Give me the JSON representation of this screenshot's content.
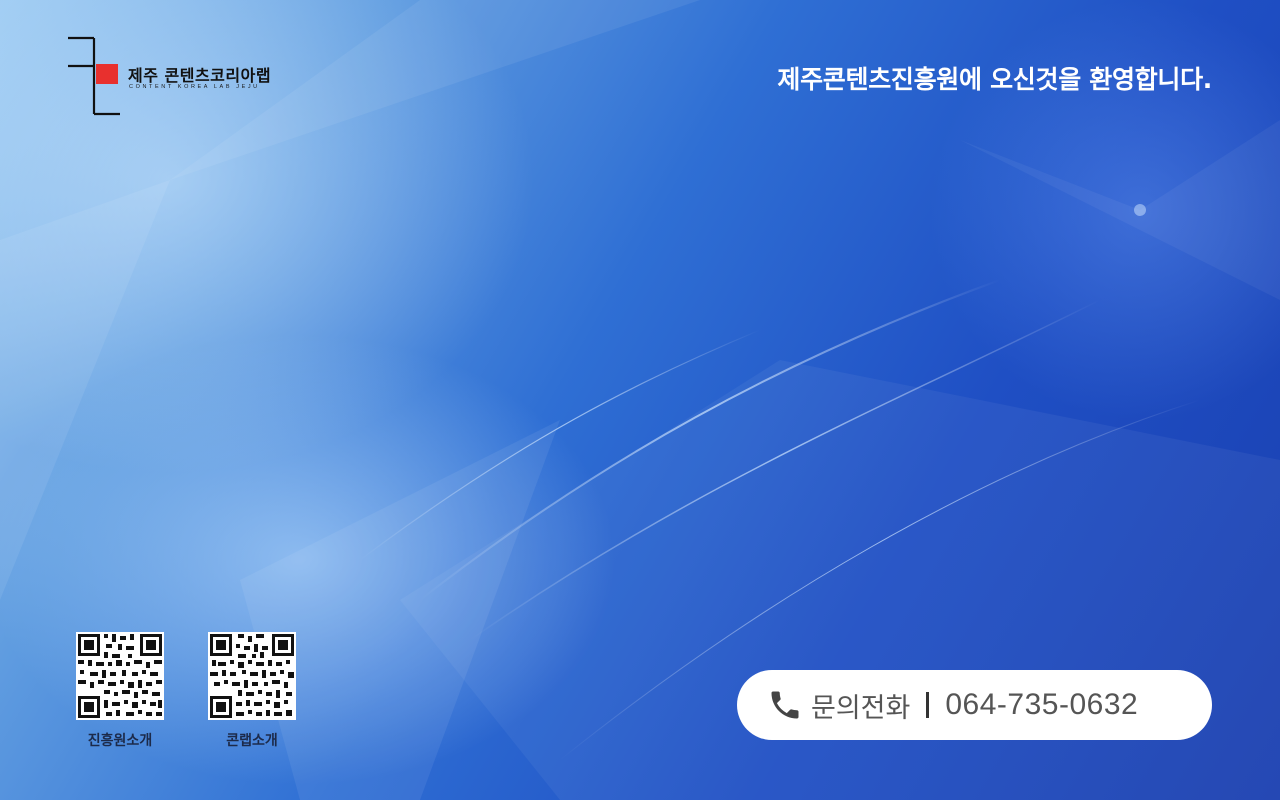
{
  "logo": {
    "title": "제주 콘텐츠코리아랩",
    "subtitle": "CONTENT KOREA LAB JEJU"
  },
  "welcome": "제주콘텐츠진흥원에 오신것을 환영합니다.",
  "qr_codes": [
    {
      "label": "진흥원소개"
    },
    {
      "label": "콘랩소개"
    }
  ],
  "contact": {
    "icon": "phone-icon",
    "label": "문의전화",
    "number": "064-735-0632"
  },
  "colors": {
    "accent_red": "#e8302e",
    "background_blue": "#1f4fc4",
    "pill": "#ffffff"
  }
}
